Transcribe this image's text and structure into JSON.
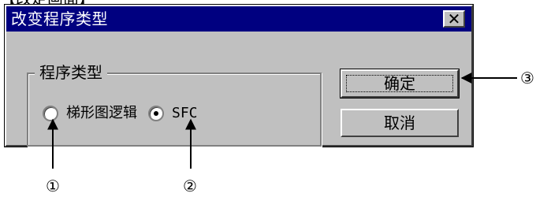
{
  "top_cutoff_text": "【改定画面】",
  "dialog": {
    "title": "改变程序类型",
    "close_glyph": "✕",
    "group": {
      "label": "程序类型",
      "options": [
        {
          "label": "梯形图逻辑",
          "selected": false
        },
        {
          "label": "SFC",
          "selected": true
        }
      ]
    },
    "buttons": {
      "ok": "确定",
      "cancel": "取消"
    }
  },
  "annotations": {
    "marker_1": "①",
    "marker_2": "②",
    "marker_3": "③"
  },
  "colors": {
    "titlebar": "#000080",
    "dialog_face": "#c0c0c0",
    "highlight": "#ffffff",
    "shadow": "#808080",
    "dark_shadow": "#404040"
  }
}
